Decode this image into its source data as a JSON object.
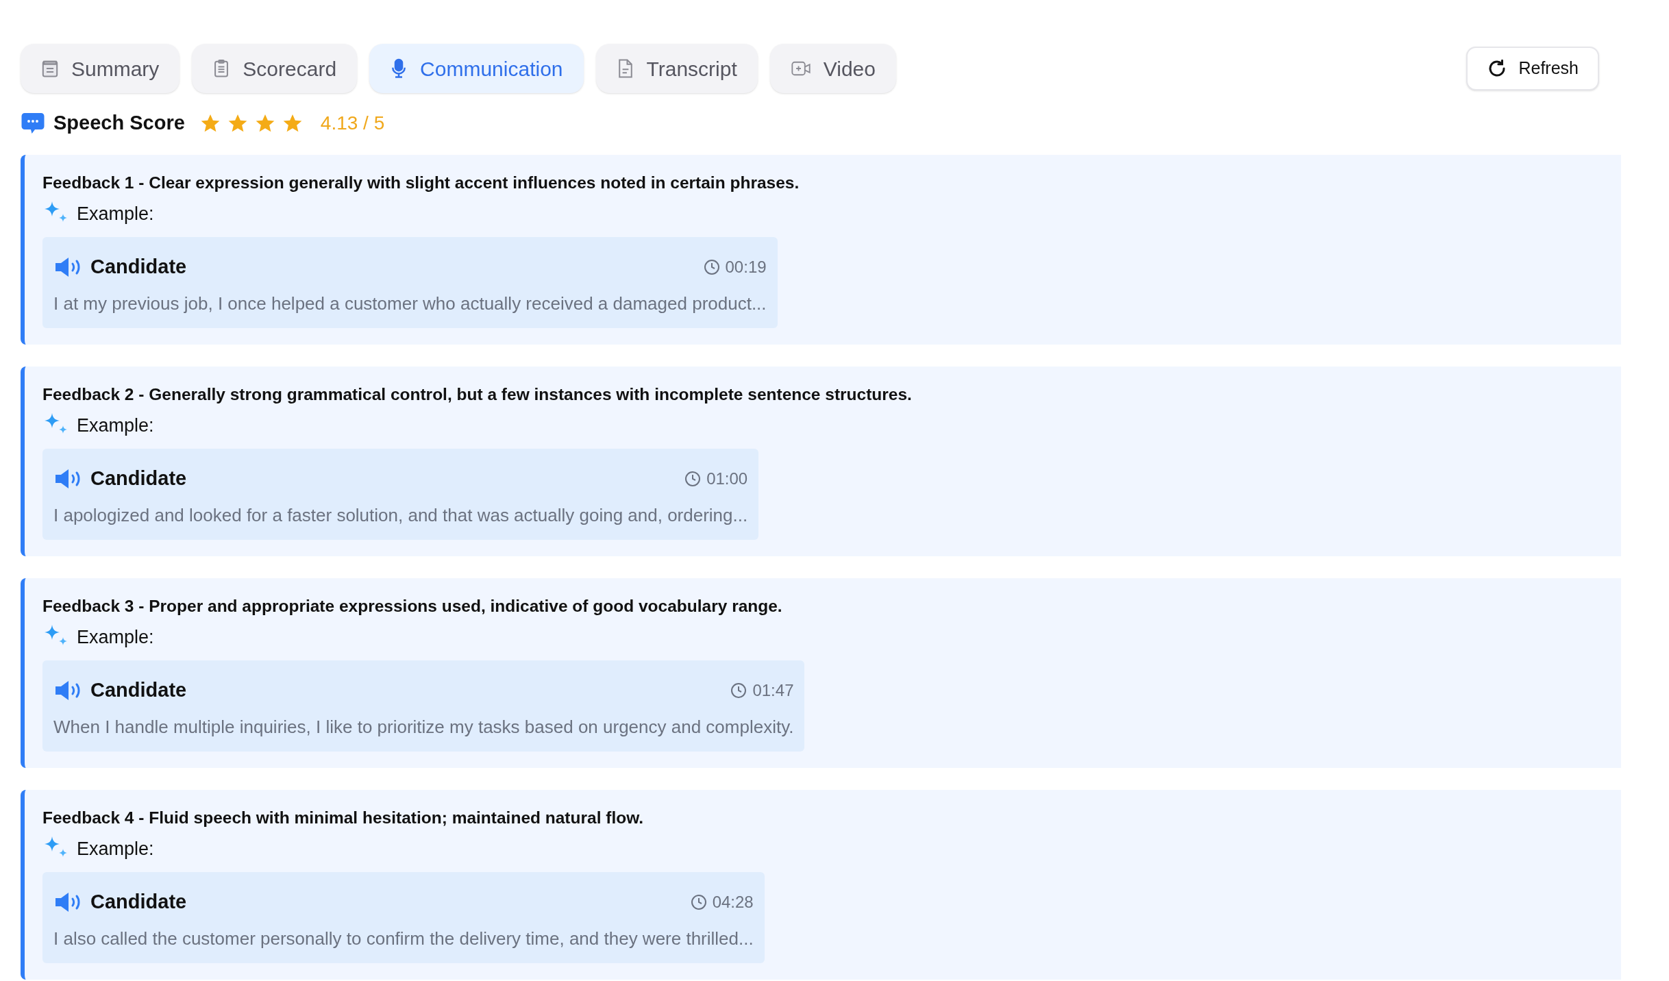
{
  "tabs": [
    {
      "label": "Summary",
      "kind": "summary",
      "selected": false
    },
    {
      "label": "Scorecard",
      "kind": "clipboard",
      "selected": false
    },
    {
      "label": "Communication",
      "kind": "mic",
      "selected": true
    },
    {
      "label": "Transcript",
      "kind": "document",
      "selected": false
    },
    {
      "label": "Video",
      "kind": "video",
      "selected": false
    }
  ],
  "refresh_button": "Refresh",
  "speech_score": {
    "label": "Speech Score",
    "stars": 4,
    "score": "4.13 / 5"
  },
  "feedback": [
    {
      "title": "Feedback 1 - Clear expression generally with slight accent influences noted in certain phrases.",
      "example_label": "Example:",
      "speaker": "Candidate",
      "time": "00:19",
      "quote": "I at my previous job, I once helped a customer who actually received a damaged product..."
    },
    {
      "title": "Feedback 2 - Generally strong grammatical control, but a few instances with incomplete sentence structures.",
      "example_label": "Example:",
      "speaker": "Candidate",
      "time": "01:00",
      "quote": "I apologized and looked for a faster solution, and that was actually going and, ordering..."
    },
    {
      "title": "Feedback 3 - Proper and appropriate expressions used, indicative of good vocabulary range.",
      "example_label": "Example:",
      "speaker": "Candidate",
      "time": "01:47",
      "quote": "When I handle multiple inquiries, I like to prioritize my tasks based on urgency and complexity."
    },
    {
      "title": "Feedback 4 - Fluid speech with minimal hesitation; maintained natural flow.",
      "example_label": "Example:",
      "speaker": "Candidate",
      "time": "04:28",
      "quote": "I also called the customer personally to confirm the delivery time, and they were thrilled..."
    }
  ]
}
